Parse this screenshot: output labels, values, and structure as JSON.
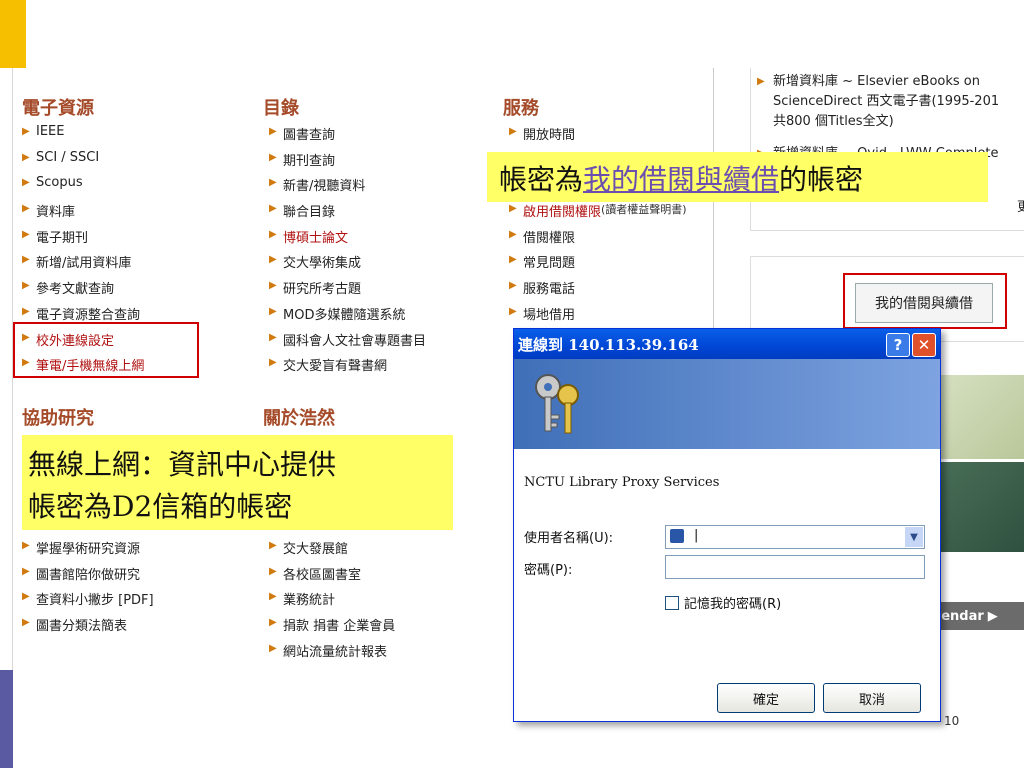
{
  "library": {
    "sections": {
      "eresources": "電子資源",
      "catalog": "目錄",
      "services": "服務",
      "research": "協助研究",
      "about": "關於浩然"
    },
    "eresources_items": [
      "IEEE",
      "SCI / SSCI",
      "Scopus",
      "資料庫",
      "電子期刊",
      "新增/試用資料庫",
      "參考文獻查詢",
      "電子資源整合查詢",
      "校外連線設定",
      "筆電/手機無線上網"
    ],
    "catalog_items": [
      "圖書查詢",
      "期刊查詢",
      "新書/視聽資料",
      "聯合目錄",
      "博碩士論文",
      "交大學術集成",
      "研究所考古題",
      "MOD多媒體隨選系統",
      "國科會人文社會專題書目",
      "交大愛盲有聲書網"
    ],
    "services_items": [
      "開放時間",
      "",
      "",
      "啟用借閱權限",
      "借閱權限",
      "常見問題",
      "服務電話",
      "場地借用"
    ],
    "services_note": "(讀者權益聲明書)",
    "research_items": [
      "掌握學術研究資源",
      "圖書館陪你做研究",
      "查資料小撇步 [PDF]",
      "圖書分類法簡表"
    ],
    "about_items": [
      "交大發展館",
      "各校區圖書室",
      "業務統計",
      "捐款 捐書 企業會員",
      "網站流量統計報表"
    ]
  },
  "right_panel": {
    "news1_line1": "新增資料庫 ~ Elsevier eBooks on",
    "news1_line2": "ScienceDirect 西文電子書(1995-201",
    "news1_line3": "共800 個Titles全文)",
    "news2": "新增資料庫 ~ Ovid - LWW Complete",
    "more": "更",
    "my_borrow_button": "我的借閱與續借",
    "calendar": "alendar"
  },
  "callouts": {
    "wifi_line1": "無線上網：資訊中心提供",
    "wifi_line2": "帳密為D2信箱的帳密",
    "account_prefix": "帳密為",
    "account_link": "我的借閱與續借",
    "account_suffix": "的帳密"
  },
  "dialog": {
    "title": "連線到 140.113.39.164",
    "realm": "NCTU Library Proxy Services",
    "username_label": "使用者名稱(U):",
    "password_label": "密碼(P):",
    "remember_label": "記憶我的密碼(R)",
    "ok": "確定",
    "cancel": "取消",
    "help_glyph": "?",
    "close_glyph": "✕",
    "username_value": "|"
  },
  "slide": {
    "page_number": "10"
  },
  "colors": {
    "section_title": "#a54b2a",
    "highlight": "#ffff66",
    "redbox": "#d00000",
    "titlebar": "#0046d5"
  }
}
